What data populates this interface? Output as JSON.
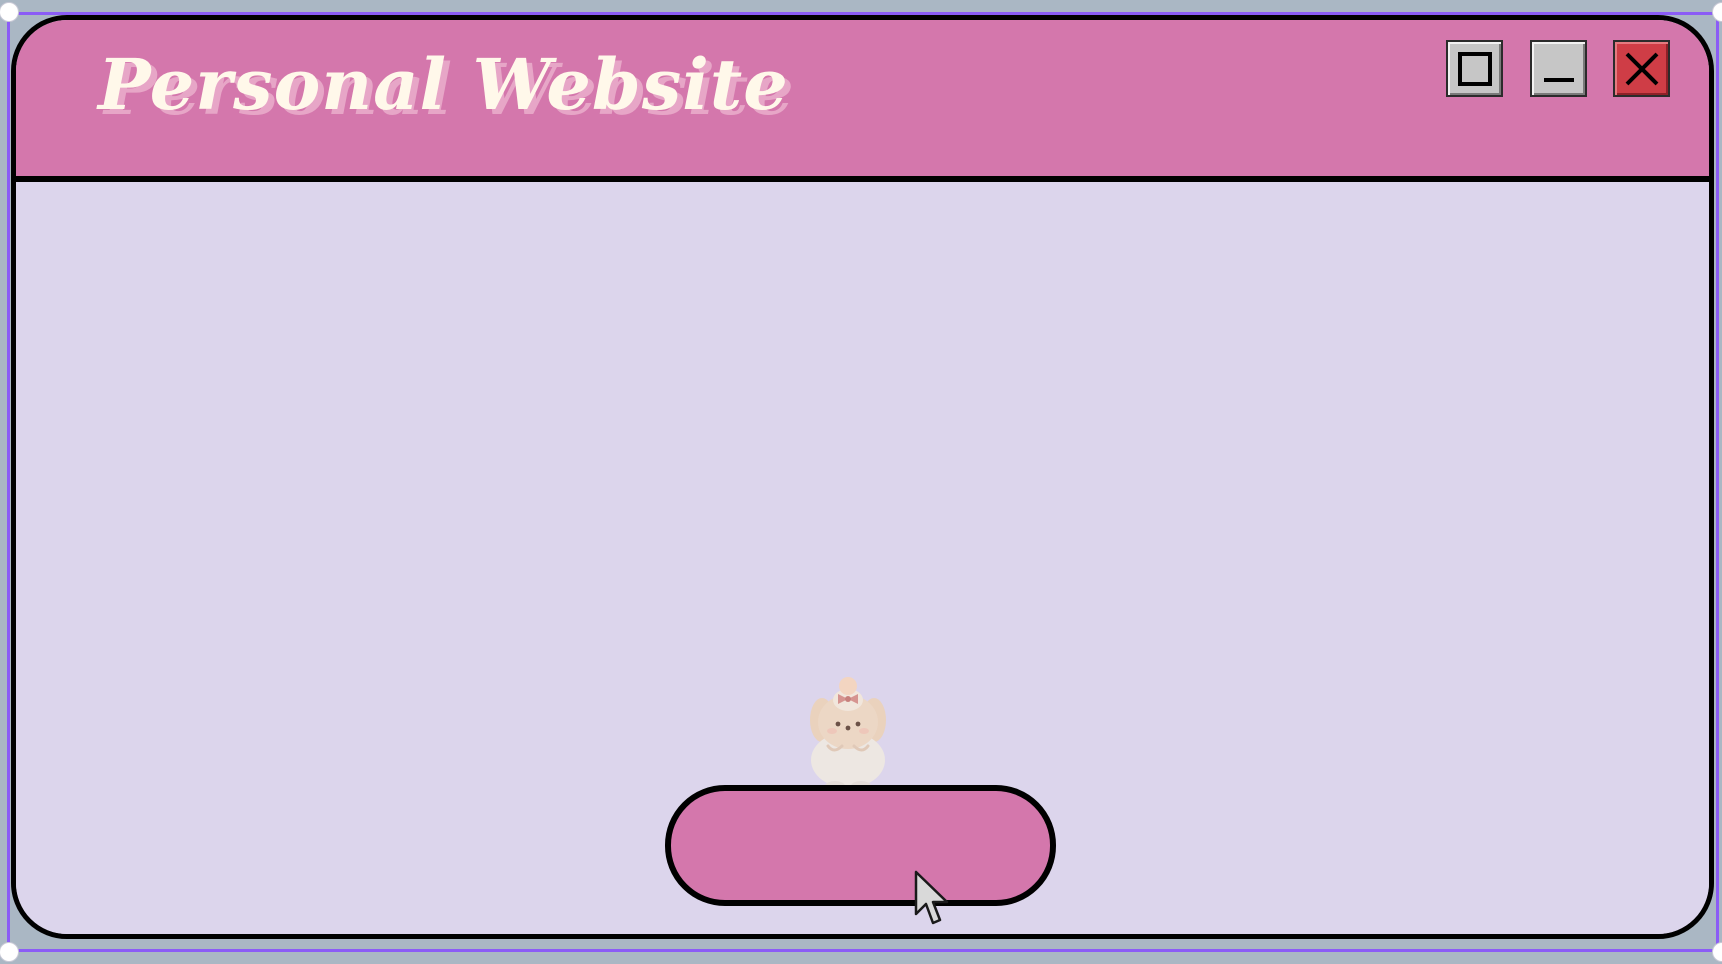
{
  "window": {
    "title": "Personal Website"
  },
  "controls": {
    "maximize_icon": "maximize-square-icon",
    "minimize_icon": "minimize-underscore-icon",
    "close_icon": "close-x-icon"
  },
  "content": {
    "mascot_icon": "puppy-with-bow-icon",
    "enter_button_label": ""
  },
  "colors": {
    "titlebar": "#d477ac",
    "title_text": "#fff8ea",
    "title_shadow": "#e7a6c7",
    "content_bg": "#dcd5ec",
    "button_fill": "#d477ac",
    "close_button": "#cf3d46",
    "window_control": "#c6c6c6",
    "outline": "#000000",
    "desktop_bg": "#aab7c4",
    "selection": "#8b5cf6"
  }
}
